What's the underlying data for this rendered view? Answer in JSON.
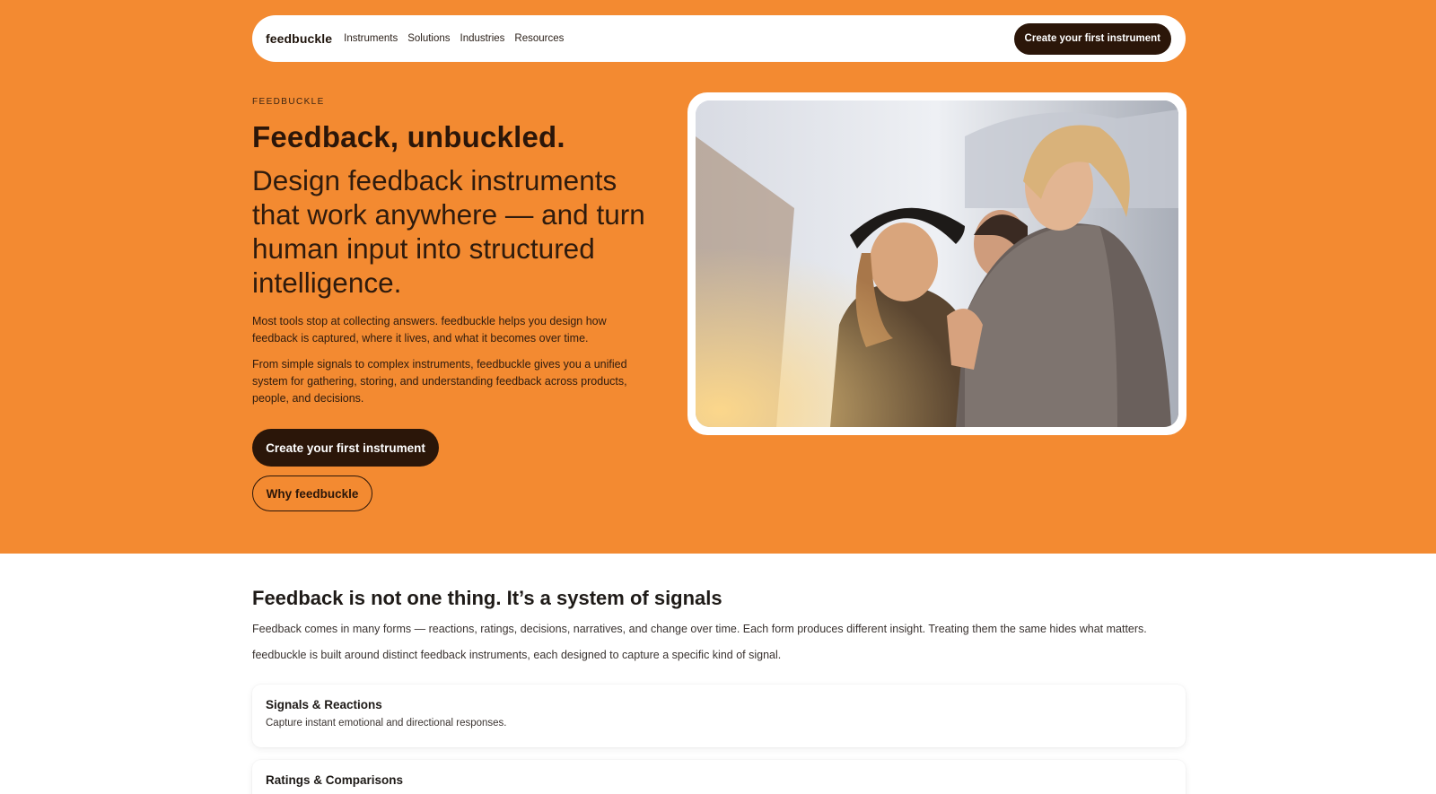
{
  "nav": {
    "brand": "feedbuckle",
    "links": [
      "Instruments",
      "Solutions",
      "Industries",
      "Resources"
    ],
    "cta": "Create your first instrument"
  },
  "hero": {
    "eyebrow": "FEEDBUCKLE",
    "title": "Feedback, unbuckled.",
    "subtitle": "Design feedback instruments that work anywhere — and turn human input into structured intelligence.",
    "paragraph1": "Most tools stop at collecting answers. feedbuckle helps you design how feedback is captured, where it lives, and what it becomes over time.",
    "paragraph2": "From simple signals to complex instruments, feedbuckle gives you a unified system for gathering, storing, and understanding feedback across products, people, and decisions.",
    "primary_button": "Create your first instrument",
    "secondary_button": "Why feedbuckle"
  },
  "section": {
    "title": "Feedback is not one thing. It’s a system of signals",
    "text1": "Feedback comes in many forms — reactions, ratings, decisions, narratives, and change over time. Each form produces different insight. Treating them the same hides what matters.",
    "text2": "feedbuckle is built around distinct feedback instruments, each designed to capture a specific kind of signal.",
    "cards": [
      {
        "title": "Signals & Reactions",
        "description": "Capture instant emotional and directional responses."
      },
      {
        "title": "Ratings & Comparisons",
        "description": ""
      }
    ]
  },
  "colors": {
    "hero_background": "#f38a31",
    "dark_accent": "#2b1609"
  }
}
